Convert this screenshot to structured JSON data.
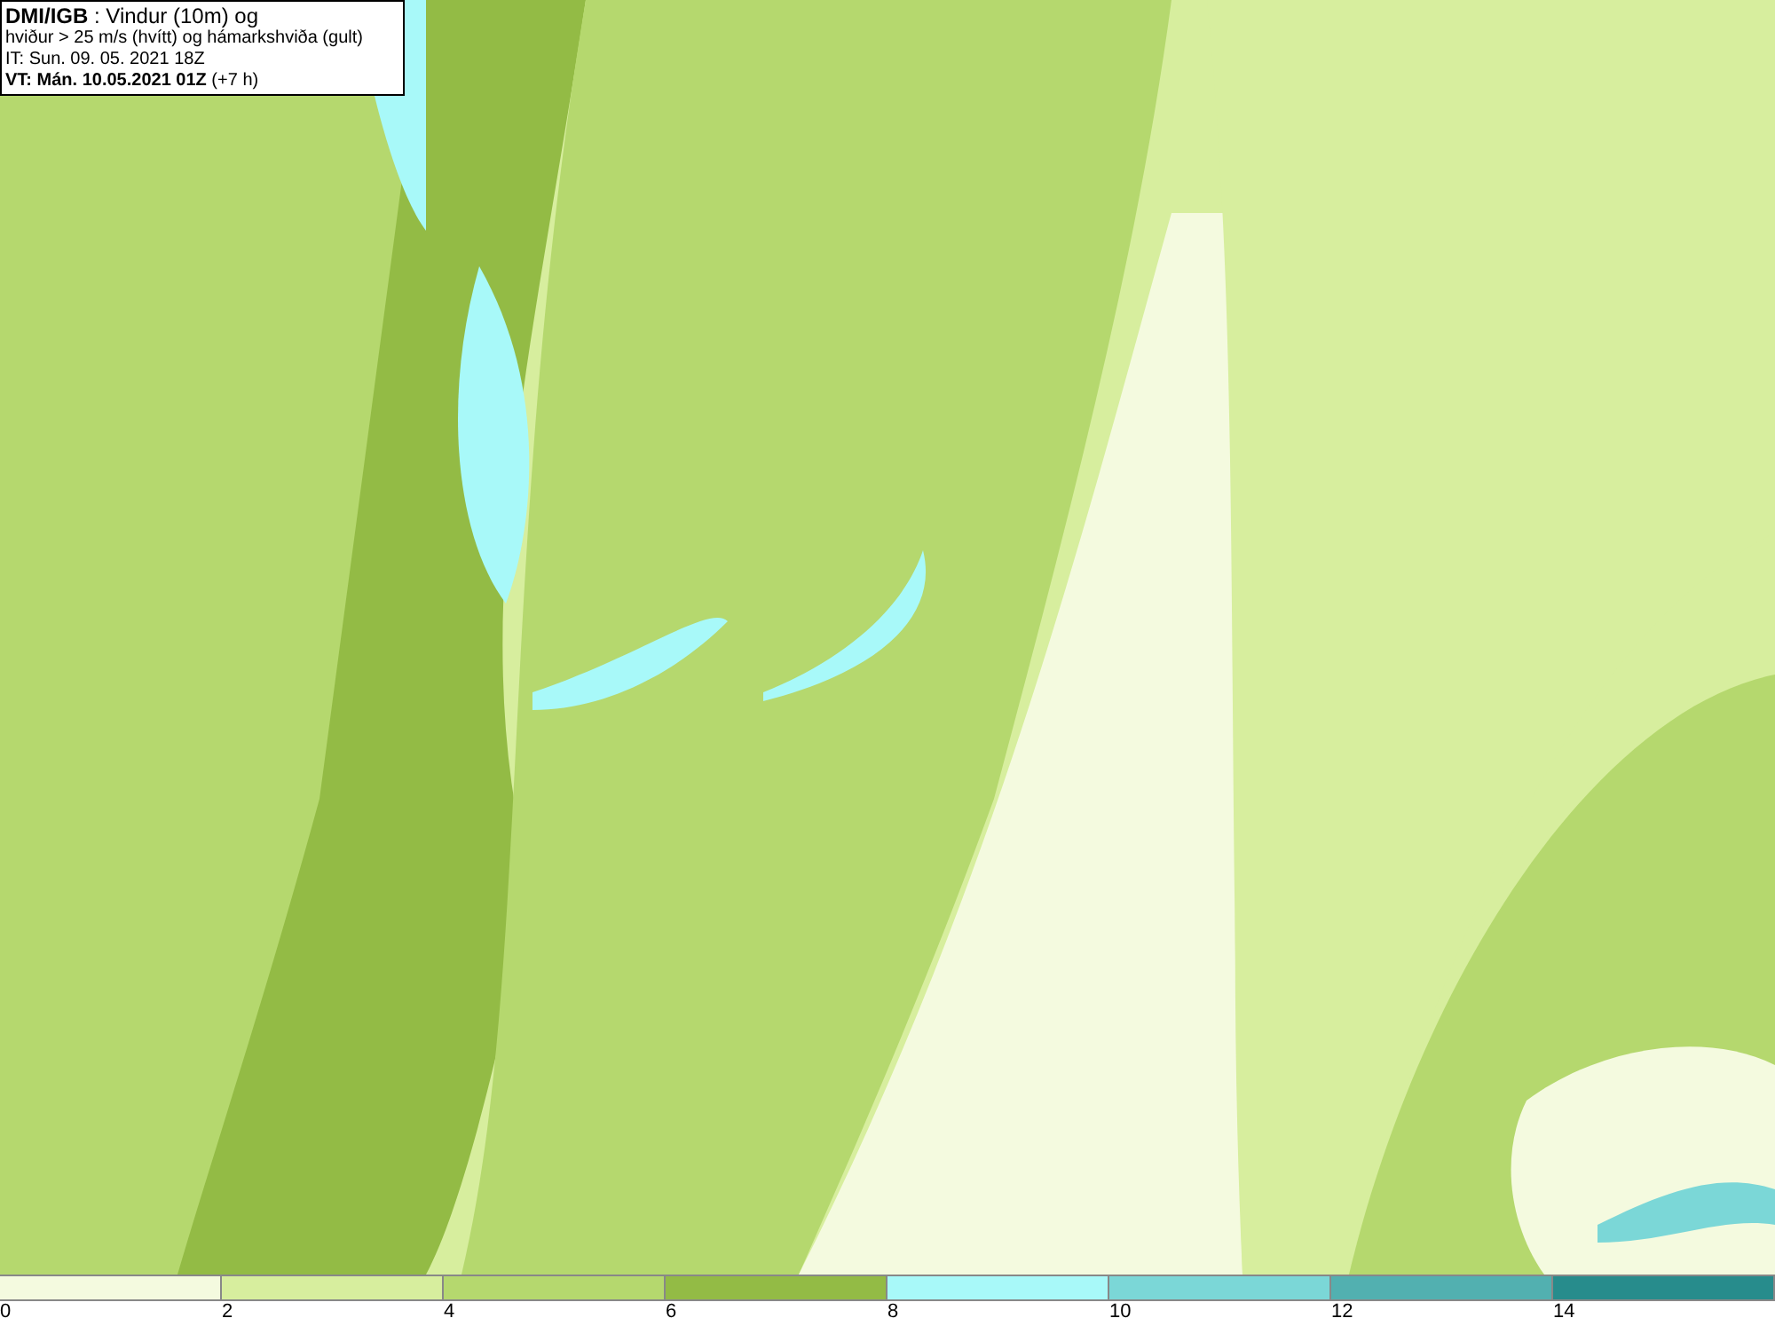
{
  "header": {
    "lines": [
      "**DMI/IGB** : Vindur (10m) og",
      "hviður > 25 m/s (hvítt) og hámarkshviða (gult)",
      "IT: Sun. 09. 05. 2021 18Z",
      "**VT: Mán. 10.05.2021 01Z** (+7 h)"
    ]
  },
  "legend": [
    {
      "label": "0",
      "color": "#f4fadf"
    },
    {
      "label": "2",
      "color": "#d7ee9e"
    },
    {
      "label": "4",
      "color": "#b5d86e"
    },
    {
      "label": "6",
      "color": "#93bb45"
    },
    {
      "label": "8",
      "color": "#a8f9f9"
    },
    {
      "label": "10",
      "color": "#7bd7d7"
    },
    {
      "label": "12",
      "color": "#52b0b0"
    },
    {
      "label": "14",
      "color": "#278c8c"
    }
  ]
}
